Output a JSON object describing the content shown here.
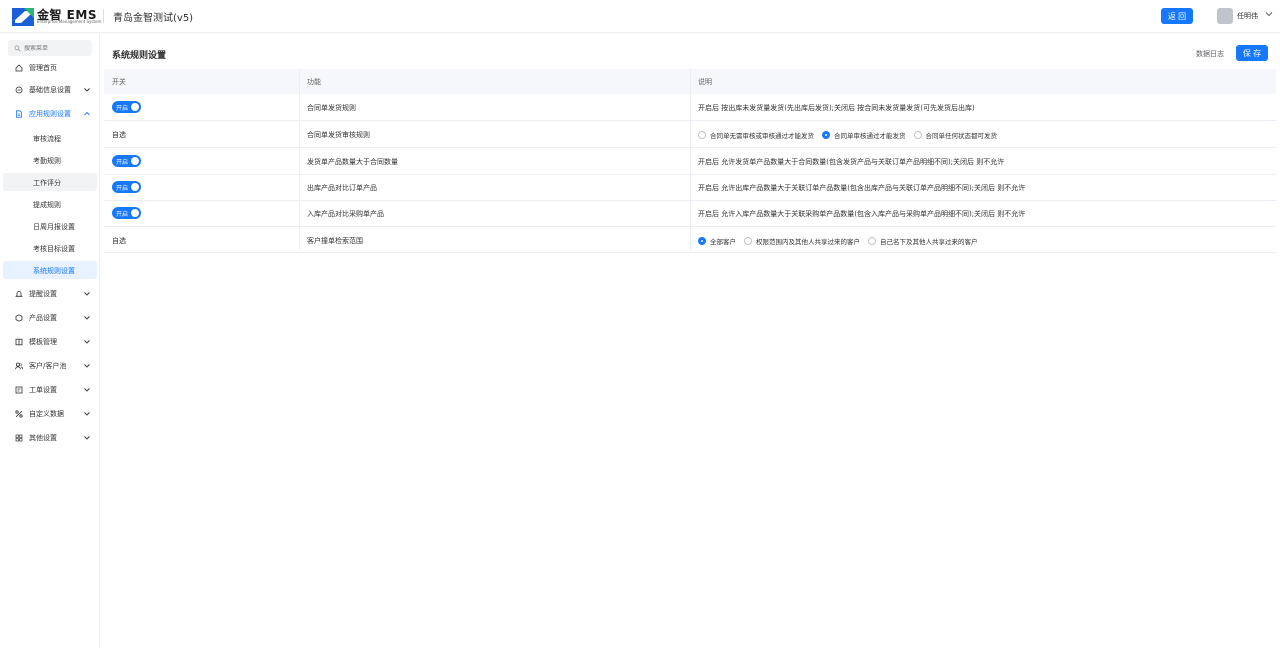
{
  "header": {
    "logo_text": "金智 EMS",
    "logo_sub": "Enterprise Management System",
    "app_title": "青岛金智测试(v5)",
    "back_label": "返 回",
    "user_name": "任明伟"
  },
  "sidebar": {
    "search_placeholder": "搜索菜单",
    "items": [
      {
        "label": "管理首页",
        "icon": "home-icon"
      },
      {
        "label": "基础信息设置",
        "icon": "info-icon"
      },
      {
        "label": "应用规则设置",
        "icon": "document-icon"
      },
      {
        "label": "提醒设置",
        "icon": "bell-icon"
      },
      {
        "label": "产品设置",
        "icon": "cube-icon"
      },
      {
        "label": "模板管理",
        "icon": "book-icon"
      },
      {
        "label": "客户/客户池",
        "icon": "users-icon"
      },
      {
        "label": "工单设置",
        "icon": "ticket-icon"
      },
      {
        "label": "自定义数据",
        "icon": "custom-icon"
      },
      {
        "label": "其他设置",
        "icon": "grid-icon"
      }
    ],
    "sub_items": [
      "审核流程",
      "考勤规则",
      "工作评分",
      "提成规则",
      "日周月报设置",
      "考核目标设置",
      "系统规则设置"
    ]
  },
  "main": {
    "title": "系统规则设置",
    "log_label": "数据日志",
    "save_label": "保 存",
    "columns": [
      "开关",
      "功能",
      "说明"
    ],
    "switch_on_label": "开启",
    "rows": [
      {
        "switch": "开启",
        "feature": "合同单发货规则",
        "desc": "开启后 按出库未发货量发货(先出库后发货);关闭后 按合同未发货量发货(可先发货后出库)"
      },
      {
        "switch": "自选",
        "feature": "合同单发货审核规则",
        "options": [
          "合同单无需审核或审核通过才能发货",
          "合同单审核通过才能发货",
          "合同单任何状态都可发货"
        ],
        "selected": 1
      },
      {
        "switch": "开启",
        "feature": "发货单产品数量大于合同数量",
        "desc": "开启后 允许发货单产品数量大于合同数量(包含发货产品与关联订单产品明细不同);关闭后 则不允许"
      },
      {
        "switch": "开启",
        "feature": "出库产品对比订单产品",
        "desc": "开启后 允许出库产品数量大于关联订单产品数量(包含出库产品与关联订单产品明细不同);关闭后 则不允许"
      },
      {
        "switch": "开启",
        "feature": "入库产品对比采购单产品",
        "desc": "开启后 允许入库产品数量大于关联采购单产品数量(包含入库产品与采购单产品明细不同);关闭后 则不允许"
      },
      {
        "switch": "自选",
        "feature": "客户撞单检索范围",
        "options": [
          "全部客户",
          "权限范围内及其他人共享过来的客户",
          "自己名下及其他人共享过来的客户"
        ],
        "selected": 0
      }
    ]
  },
  "colors": {
    "accent": "#1677ff"
  }
}
